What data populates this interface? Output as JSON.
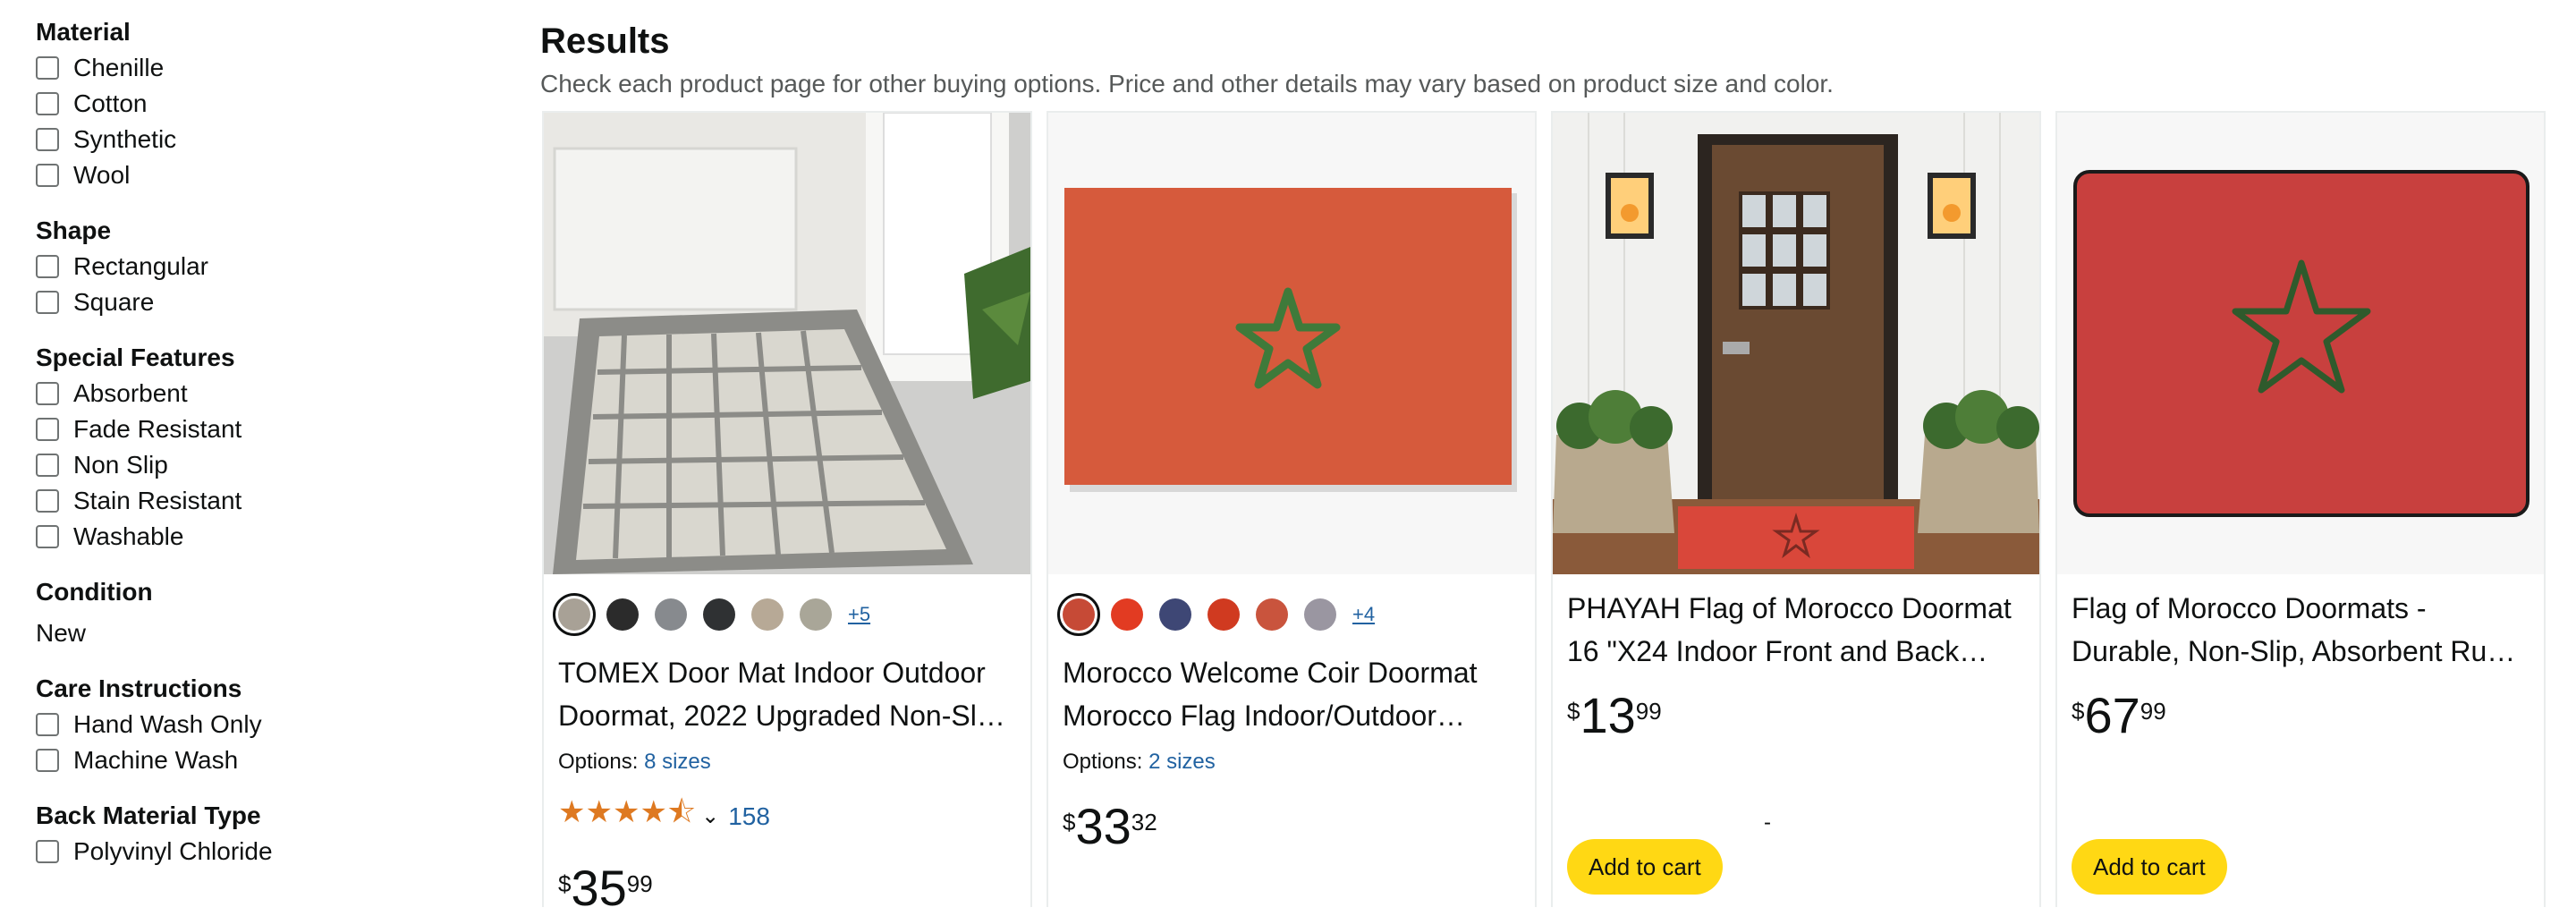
{
  "sidebar": {
    "material": {
      "title": "Material",
      "items": [
        "Chenille",
        "Cotton",
        "Synthetic",
        "Wool"
      ]
    },
    "shape": {
      "title": "Shape",
      "items": [
        "Rectangular",
        "Square"
      ]
    },
    "special_features": {
      "title": "Special Features",
      "items": [
        "Absorbent",
        "Fade Resistant",
        "Non Slip",
        "Stain Resistant",
        "Washable"
      ]
    },
    "condition": {
      "title": "Condition",
      "value": "New"
    },
    "care": {
      "title": "Care Instructions",
      "items": [
        "Hand Wash Only",
        "Machine Wash"
      ]
    },
    "back_material": {
      "title": "Back Material Type",
      "items": [
        "Polyvinyl Chloride"
      ]
    }
  },
  "results": {
    "title": "Results",
    "subtitle": "Check each product page for other buying options. Price and other details may vary based on product size and color."
  },
  "products": [
    {
      "swatches": [
        "#a8a196",
        "#2b2b2b",
        "#878a8e",
        "#2f3133",
        "#b7a996",
        "#a9a698"
      ],
      "more": "+5",
      "title": "TOMEX Door Mat Indoor Outdoor Doormat, 2022 Upgraded Non-Sl…",
      "options_label": "Options:",
      "options_link": "8 sizes",
      "stars": "★★★★⯪",
      "rating_count": "158",
      "price_symbol": "$",
      "price_whole": "35",
      "price_fraction": "99"
    },
    {
      "swatches": [
        "#c64a36",
        "#e23b22",
        "#3e4775",
        "#d03a20",
        "#c9543d",
        "#9a96a1"
      ],
      "more": "+4",
      "title": "Morocco Welcome Coir Doormat Morocco Flag Indoor/Outdoor…",
      "options_label": "Options:",
      "options_link": "2 sizes",
      "price_symbol": "$",
      "price_whole": "33",
      "price_fraction": "32"
    },
    {
      "title": "PHAYAH Flag of Morocco Doormat 16 \"X24 Indoor Front and Back…",
      "price_symbol": "$",
      "price_whole": "13",
      "price_fraction": "99",
      "dash": "-",
      "cart_label": "Add to cart"
    },
    {
      "title": "Flag of Morocco Doormats - Durable, Non-Slip, Absorbent Ru…",
      "price_symbol": "$",
      "price_whole": "67",
      "price_fraction": "99",
      "cart_label": "Add to cart"
    }
  ]
}
